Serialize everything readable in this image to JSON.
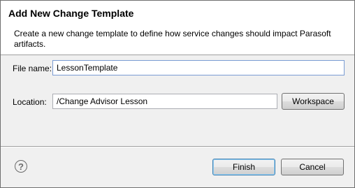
{
  "dialog": {
    "title": "Add New Change Template",
    "description": "Create a new change template to define how service changes should impact Parasoft artifacts."
  },
  "form": {
    "file_name_label": "File name:",
    "file_name_value": "LessonTemplate",
    "location_label": "Location:",
    "location_value": "/Change Advisor Lesson",
    "workspace_button": "Workspace"
  },
  "footer": {
    "help_icon": "help-icon",
    "help_glyph": "?",
    "finish_button": "Finish",
    "cancel_button": "Cancel"
  }
}
